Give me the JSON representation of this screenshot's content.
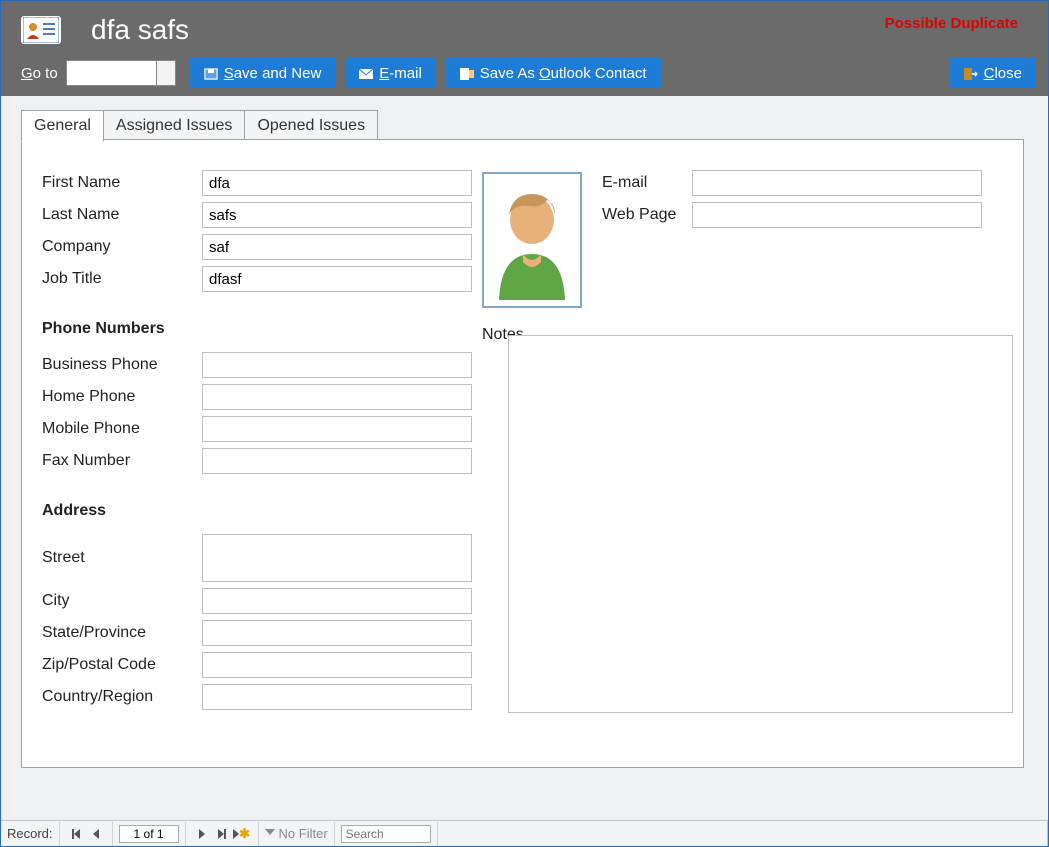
{
  "header": {
    "title": "dfa safs",
    "warning": "Possible Duplicate",
    "goto_label_pre": "G",
    "goto_label_post": "o to"
  },
  "toolbar": {
    "save_new_pre": "S",
    "save_new_post": "ave and New",
    "email_pre": "E",
    "email_post": "-mail",
    "outlook_pre": "Save As ",
    "outlook_u": "O",
    "outlook_post": "utlook Contact",
    "close_pre": "C",
    "close_post": "lose"
  },
  "tabs": {
    "general": "General",
    "assigned": "Assigned Issues",
    "opened": "Opened Issues"
  },
  "labels": {
    "first_name": "First Name",
    "last_name": "Last Name",
    "company": "Company",
    "job_title": "Job Title",
    "phone_section": "Phone Numbers",
    "business_phone": "Business Phone",
    "home_phone": "Home Phone",
    "mobile_phone": "Mobile Phone",
    "fax_number": "Fax Number",
    "address_section": "Address",
    "street": "Street",
    "city": "City",
    "state": "State/Province",
    "zip": "Zip/Postal Code",
    "country": "Country/Region",
    "email": "E-mail",
    "webpage": "Web Page",
    "notes": "Notes"
  },
  "values": {
    "first_name": "dfa",
    "last_name": "safs",
    "company": "saf",
    "job_title": "dfasf",
    "business_phone": "",
    "home_phone": "",
    "mobile_phone": "",
    "fax_number": "",
    "street": "",
    "city": "",
    "state": "",
    "zip": "",
    "country": "",
    "email": "",
    "webpage": "",
    "notes": ""
  },
  "status": {
    "record_label": "Record:",
    "record_pos": "1 of 1",
    "no_filter": "No Filter",
    "search_placeholder": "Search"
  }
}
